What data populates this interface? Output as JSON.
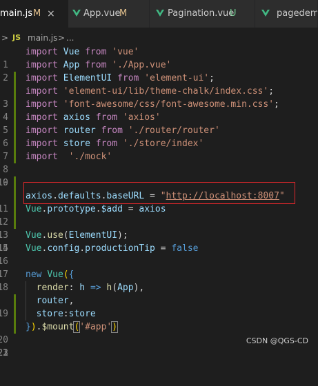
{
  "tabs": [
    {
      "name": "main.js",
      "badge": "M",
      "badge_type": "modified",
      "close": "×",
      "icon": "js-file-icon"
    },
    {
      "name": "App.vue",
      "badge": "M",
      "badge_type": "modified",
      "icon": "vue-file-icon"
    },
    {
      "name": "Pagination.vue",
      "badge": "U",
      "badge_type": "untracked",
      "icon": "vue-file-icon"
    },
    {
      "name": "pagedemo",
      "icon": "vue-file-icon"
    }
  ],
  "breadcrumb": {
    "chevron": ">",
    "js_icon": "JS",
    "file": "main.js",
    "separator": ">",
    "rest": "..."
  },
  "lines": [
    {
      "n": "1",
      "t": "import Vue from 'vue'"
    },
    {
      "n": "2",
      "t": "import App from './App.vue'"
    },
    {
      "n": "3",
      "t": "import ElementUI from 'element-ui';"
    },
    {
      "n": "4",
      "t": "import 'element-ui/lib/theme-chalk/index.css';"
    },
    {
      "n": "5",
      "t": "import 'font-awesome/css/font-awesome.min.css';"
    },
    {
      "n": "6",
      "t": "import axios from 'axios'"
    },
    {
      "n": "7",
      "t": "import router from './router/router'"
    },
    {
      "n": "8",
      "t": "import store from './store/index'"
    },
    {
      "n": "9",
      "t": "import  './mock'"
    },
    {
      "n": "10",
      "t": ""
    },
    {
      "n": "11",
      "t": ""
    },
    {
      "n": "12",
      "t": "axios.defaults.baseURL = \"http://localhost:8007\""
    },
    {
      "n": "13",
      "t": "Vue.prototype.$add = axios"
    },
    {
      "n": "14",
      "t": ""
    },
    {
      "n": "15",
      "t": "Vue.use(ElementUI);"
    },
    {
      "n": "16",
      "t": "Vue.config.productionTip = false"
    },
    {
      "n": "17",
      "t": ""
    },
    {
      "n": "18",
      "t": "new Vue({"
    },
    {
      "n": "19",
      "t": "  render: h => h(App),"
    },
    {
      "n": "20",
      "t": "  router,"
    },
    {
      "n": "21",
      "t": "  store:store"
    },
    {
      "n": "22",
      "t": "}).$mount('#app')"
    },
    {
      "n": "23",
      "t": ""
    }
  ],
  "watermark": "CSDN @QGS-CD",
  "colors": {
    "background": "#1e1e1e",
    "keyword": "#c586c0",
    "variable": "#9cdcfe",
    "class": "#4ec9b0",
    "string": "#ce9178",
    "function": "#dcdcaa",
    "boolean": "#569cd6",
    "modified_badge": "#e2c08d",
    "untracked_badge": "#73c991",
    "highlight_box": "#e0282b",
    "git_gutter": "#587c0c"
  }
}
